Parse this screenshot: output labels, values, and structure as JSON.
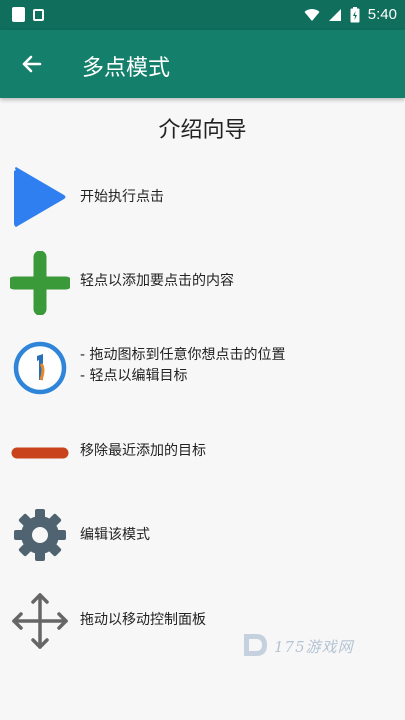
{
  "status_bar": {
    "time": "5:40",
    "icons": [
      "notification-icon",
      "image-icon",
      "wifi-icon",
      "signal-icon",
      "battery-icon"
    ]
  },
  "app_bar": {
    "title": "多点模式",
    "back_icon": "back-arrow-icon"
  },
  "page": {
    "title": "介绍向导",
    "items": [
      {
        "icon": "play-icon",
        "lines": [
          "开始执行点击"
        ]
      },
      {
        "icon": "plus-icon",
        "lines": [
          "轻点以添加要点击的内容"
        ]
      },
      {
        "icon": "target-icon",
        "lines": [
          "- 拖动图标到任意你想点击的位置",
          "- 轻点以编辑目标"
        ]
      },
      {
        "icon": "remove-icon",
        "lines": [
          "移除最近添加的目标"
        ]
      },
      {
        "icon": "gear-icon",
        "lines": [
          "编辑该模式"
        ]
      },
      {
        "icon": "move-icon",
        "lines": [
          "拖动以移动控制面板"
        ]
      }
    ]
  },
  "watermark": {
    "text": "175游戏网"
  },
  "colors": {
    "status_bar": "#0f6e5c",
    "app_bar": "#14806b",
    "play": "#2f7ff0",
    "plus": "#3a9a3a",
    "remove": "#c9441c",
    "target_ring": "#2f86d8",
    "target_center": "#e88a2a",
    "gear": "#4f6470",
    "move": "#666666"
  }
}
